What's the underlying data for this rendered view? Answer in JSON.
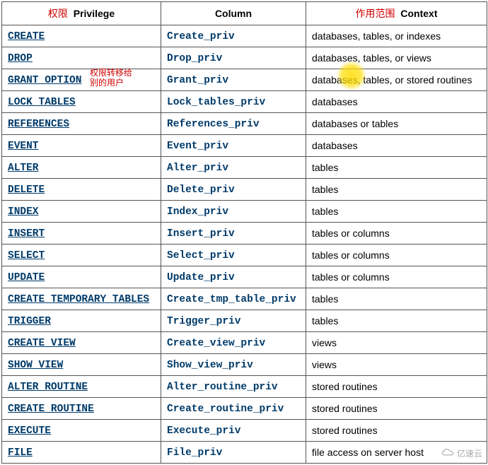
{
  "headers": {
    "privilege_red": "权限",
    "privilege": "Privilege",
    "column": "Column",
    "context_red": "作用范围",
    "context": "Context"
  },
  "annotation": "权限转移给\n别的用户",
  "watermark_text": "亿速云",
  "rows": [
    {
      "privilege": "CREATE",
      "column": "Create_priv",
      "context": "databases, tables, or indexes"
    },
    {
      "privilege": "DROP",
      "column": "Drop_priv",
      "context": "databases, tables, or views"
    },
    {
      "privilege": "GRANT OPTION",
      "column": "Grant_priv",
      "context": "databases, tables, or stored routines"
    },
    {
      "privilege": "LOCK TABLES",
      "column": "Lock_tables_priv",
      "context": "databases"
    },
    {
      "privilege": "REFERENCES",
      "column": "References_priv",
      "context": "databases or tables"
    },
    {
      "privilege": "EVENT",
      "column": "Event_priv",
      "context": "databases"
    },
    {
      "privilege": "ALTER",
      "column": "Alter_priv",
      "context": "tables"
    },
    {
      "privilege": "DELETE",
      "column": "Delete_priv",
      "context": "tables"
    },
    {
      "privilege": "INDEX",
      "column": "Index_priv",
      "context": "tables"
    },
    {
      "privilege": "INSERT",
      "column": "Insert_priv",
      "context": "tables or columns"
    },
    {
      "privilege": "SELECT",
      "column": "Select_priv",
      "context": "tables or columns"
    },
    {
      "privilege": "UPDATE",
      "column": "Update_priv",
      "context": "tables or columns"
    },
    {
      "privilege": "CREATE TEMPORARY TABLES",
      "column": "Create_tmp_table_priv",
      "context": "tables"
    },
    {
      "privilege": "TRIGGER",
      "column": "Trigger_priv",
      "context": "tables"
    },
    {
      "privilege": "CREATE VIEW",
      "column": "Create_view_priv",
      "context": "views"
    },
    {
      "privilege": "SHOW VIEW",
      "column": "Show_view_priv",
      "context": "views"
    },
    {
      "privilege": "ALTER ROUTINE",
      "column": "Alter_routine_priv",
      "context": "stored routines"
    },
    {
      "privilege": "CREATE ROUTINE",
      "column": "Create_routine_priv",
      "context": "stored routines"
    },
    {
      "privilege": "EXECUTE",
      "column": "Execute_priv",
      "context": "stored routines"
    },
    {
      "privilege": "FILE",
      "column": "File_priv",
      "context": "file access on server host"
    }
  ]
}
